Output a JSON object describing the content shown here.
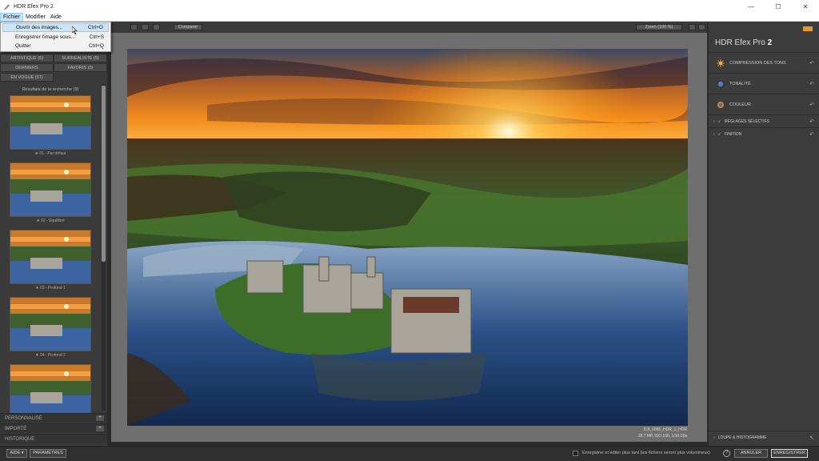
{
  "window": {
    "title": "HDR Efex Pro 2",
    "minimize": "—",
    "maximize": "☐",
    "close": "✕"
  },
  "menubar": {
    "items": [
      "Fichier",
      "Modifier",
      "Aide"
    ]
  },
  "file_menu": {
    "items": [
      {
        "label": "Ouvrir des images...",
        "shortcut": "Ctrl+O"
      },
      {
        "label": "Enregistrer l'image sous...",
        "shortcut": "Ctrl+S"
      },
      {
        "label": "Quitter",
        "shortcut": "Ctrl+Q"
      }
    ]
  },
  "categories": [
    {
      "label": "ARTISTIQUE (6)"
    },
    {
      "label": "SURRÉALISTE (5)"
    },
    {
      "label": "DERNIERS"
    },
    {
      "label": "FAVORIS (0)"
    },
    {
      "label": "EN VOGUE (57)"
    }
  ],
  "results": {
    "title": "Résultats de la recherche (9)",
    "presets": [
      {
        "label": "★ 01 - Par défaut"
      },
      {
        "label": "★ 02 - Equilibré"
      },
      {
        "label": "★ 03 - Profond 1"
      },
      {
        "label": "★ 04 - Profond 2"
      },
      {
        "label": ""
      }
    ]
  },
  "left_sections": [
    {
      "label": "PERSONNALISÉ",
      "action": "+"
    },
    {
      "label": "IMPORTÉ",
      "action": "+"
    },
    {
      "label": "HISTORIQUE",
      "action": ""
    }
  ],
  "toolbar": {
    "compare": "Comparer",
    "zoom": "Zoom (100 %)"
  },
  "photo": {
    "filename": "DJI_0065_HDR_1_HDR",
    "info": "18.7 MP, ISO 100, 1/10-20s"
  },
  "right_panel": {
    "title": "HDR Efex Pro",
    "version": "2",
    "sections": [
      {
        "label": "COMPRESSION DES TONS"
      },
      {
        "label": "TONALITÉ"
      },
      {
        "label": "COULEUR"
      }
    ],
    "collapsibles": [
      {
        "label": "RÉGLAGES SÉLECTIFS"
      },
      {
        "label": "FINITION"
      }
    ],
    "loupe": "LOUPE & HISTOGRAMME"
  },
  "bottom": {
    "help": "AIDE",
    "settings": "PARAMÈTRES",
    "save_later": "Enregistrer et éditer plus tard (les fichiers seront plus volumineux)",
    "cancel": "ANNULER",
    "save": "ENREGISTRER"
  }
}
